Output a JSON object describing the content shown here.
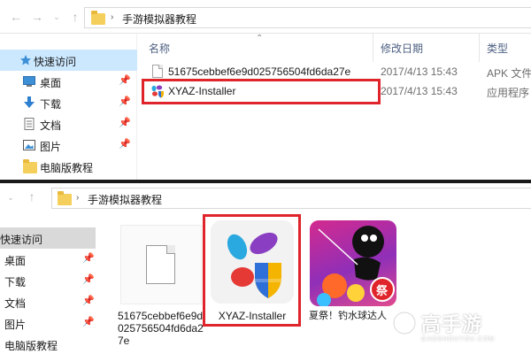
{
  "top_window": {
    "breadcrumb": {
      "folder": "手游模拟器教程"
    },
    "nav": {
      "items": [
        {
          "label": "快速访问",
          "selected": true,
          "icon": "star-icon"
        },
        {
          "label": "桌面",
          "pinned": true,
          "icon": "desktop-icon"
        },
        {
          "label": "下载",
          "pinned": true,
          "icon": "download-icon"
        },
        {
          "label": "文档",
          "pinned": true,
          "icon": "document-icon"
        },
        {
          "label": "图片",
          "pinned": true,
          "icon": "picture-icon"
        },
        {
          "label": "电脑版教程",
          "icon": "folder-icon"
        }
      ]
    },
    "columns": {
      "name": "名称",
      "date": "修改日期",
      "type": "类型"
    },
    "files": [
      {
        "name": "51675cebbef6e9d025756504fd6da27e",
        "date": "2017/4/13 15:43",
        "type": "APK 文件",
        "icon": "file-icon"
      },
      {
        "name": "XYAZ-Installer",
        "date": "2017/4/13 15:43",
        "type": "应用程序",
        "icon": "xyaz-app-icon",
        "highlighted": true
      }
    ]
  },
  "bottom_window": {
    "breadcrumb": {
      "folder": "手游模拟器教程"
    },
    "nav": {
      "items": [
        {
          "label": "快速访问",
          "selected": true
        },
        {
          "label": "桌面",
          "pinned": true
        },
        {
          "label": "下载",
          "pinned": true
        },
        {
          "label": "文档",
          "pinned": true
        },
        {
          "label": "图片",
          "pinned": true
        },
        {
          "label": "电脑版教程"
        }
      ]
    },
    "tiles": [
      {
        "name": "51675cebbef6e9d025756504fd6da27e",
        "icon": "file-icon"
      },
      {
        "name": "XYAZ-Installer",
        "icon": "xyaz-app-icon",
        "highlighted": true
      },
      {
        "name": "夏祭！钓水球达人",
        "icon": "game-icon",
        "badge": "祭"
      }
    ]
  },
  "watermark": {
    "title": "高手游",
    "subtitle": "GAOSHOUYOU.COM"
  },
  "colors": {
    "highlight": "#e0242b",
    "selection": "#cce8ff",
    "folder": "#f5cf5b"
  }
}
